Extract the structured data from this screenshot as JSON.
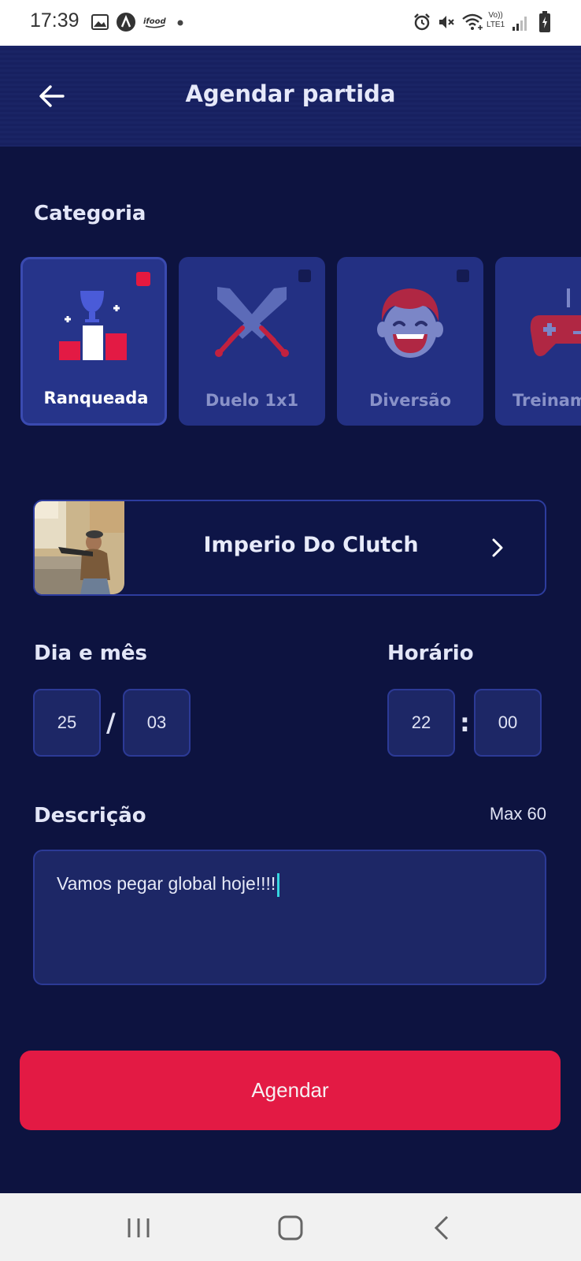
{
  "status_bar": {
    "time": "17:39",
    "icons": [
      "gallery-icon",
      "app-a-icon",
      "ifood-icon",
      "dot-icon",
      "alarm-icon",
      "mute-icon",
      "wifi-icon",
      "volte-icon",
      "signal-icon",
      "battery-icon"
    ],
    "volte_label": "Vo))",
    "lte_label": "LTE1"
  },
  "header": {
    "title": "Agendar partida",
    "back_icon": "arrow-left-icon"
  },
  "category": {
    "label": "Categoria",
    "items": [
      {
        "label": "Ranqueada",
        "icon": "podium-trophy-icon",
        "selected": true
      },
      {
        "label": "Duelo 1x1",
        "icon": "crossed-swords-icon",
        "selected": false
      },
      {
        "label": "Diversão",
        "icon": "laughing-face-icon",
        "selected": false
      },
      {
        "label": "Treinam",
        "icon": "gamepad-icon",
        "selected": false
      }
    ]
  },
  "team": {
    "name": "Imperio Do Clutch",
    "chevron_icon": "chevron-right-icon"
  },
  "date": {
    "label": "Dia e mês",
    "day": "25",
    "separator": "/",
    "month": "03"
  },
  "time": {
    "label": "Horário",
    "hour": "22",
    "separator": ":",
    "minute": "00"
  },
  "description": {
    "label": "Descrição",
    "max_label": "Max 60",
    "value": "Vamos pegar global hoje!!!!"
  },
  "submit": {
    "label": "Agendar"
  },
  "colors": {
    "background": "#0d1340",
    "card": "#233083",
    "accent_red": "#e31a44",
    "input_bg": "#1d2766"
  }
}
